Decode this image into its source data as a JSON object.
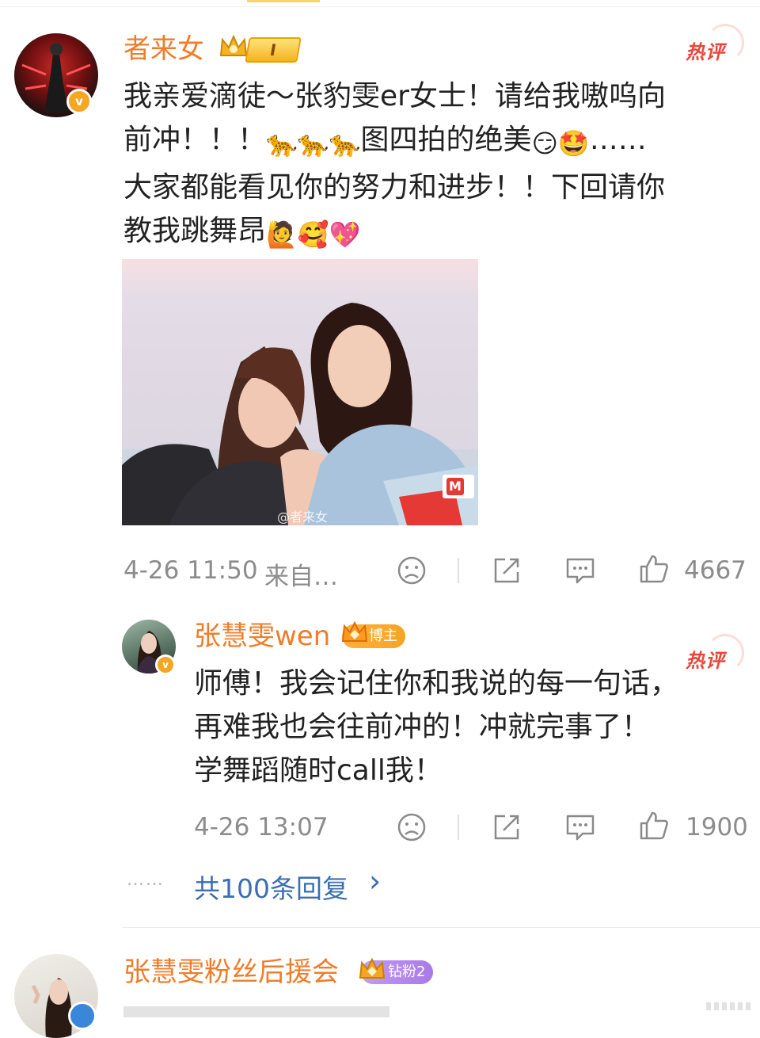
{
  "comments": [
    {
      "username": "者来女",
      "level_badge": "I",
      "hot_label": "热评",
      "text_lines": [
        "我亲爱滴徒～张豹雯er女士！请给我嗷呜向",
        "前冲！！！",
        "大家都能看见你的努力和进步！！下回请你",
        "教我跳舞昂"
      ],
      "line2_tail": "图四拍的绝美",
      "line2_end": "……",
      "image_watermark": "@者来女",
      "image_corner": "M",
      "timestamp": "4-26 11:50",
      "source": "来自…",
      "likes": "4667"
    },
    {
      "username": "张慧雯wen",
      "badge": "博主",
      "hot_label": "热评",
      "text_lines": [
        "师傅！我会记住你和我说的每一句话，",
        "再难我也会往前冲的！冲就完事了！",
        "学舞蹈随时call我！"
      ],
      "timestamp": "4-26 13:07",
      "likes": "1900"
    }
  ],
  "more_replies": {
    "dots": "……",
    "label": "共100条回复",
    "chevron": "›"
  },
  "next_comment": {
    "username": "张慧雯粉丝后援会",
    "badge": "钻粉2"
  },
  "icons": [
    "dislike-icon",
    "share-icon",
    "comment-icon",
    "like-icon",
    "v-verified-icon",
    "crown-icon"
  ],
  "colors": {
    "username": "#f07c2a",
    "hot": "#e8473a",
    "meta": "#8c8c8c",
    "badge_orange": "#f5a524",
    "badge_purple": "#b58cf0"
  }
}
